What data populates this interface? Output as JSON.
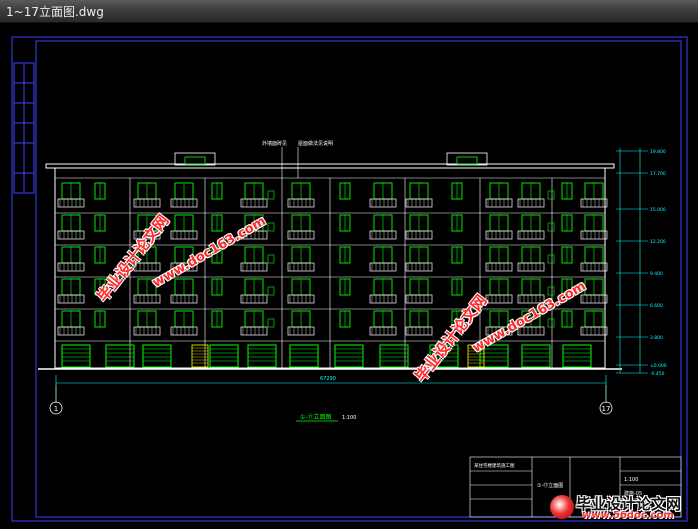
{
  "window": {
    "title": "1~17立面图.dwg"
  },
  "drawing": {
    "view_title": "①-⑰立面图",
    "view_scale": "1:100",
    "top_callouts": [
      "外墙面砖见",
      "屋面做法见说明"
    ],
    "overall_dimension": "67290",
    "axis_left": "1",
    "axis_right": "17",
    "right_elevations": [
      "19.800",
      "17.700",
      "15.000",
      "12.200",
      "9.400",
      "6.600",
      "3.800",
      "±0.000",
      "-0.450"
    ],
    "title_block": {
      "project": "某住宅楼建筑施工图",
      "drawing_name": "①-⑰立面图",
      "scale": "1:100",
      "sheet": "建施-05"
    }
  },
  "watermarks": {
    "text_cn": "毕业设计论文网",
    "text_url": "www.doc163.com",
    "logo_cn": "毕业设计论文网",
    "logo_url": "www.56doc.com"
  },
  "colors": {
    "background": "#000000",
    "outline": "#ffffff",
    "window": "#00ff00",
    "dimension": "#00ffff",
    "frame": "#4040ff",
    "watermark": "#ff2a2a"
  }
}
